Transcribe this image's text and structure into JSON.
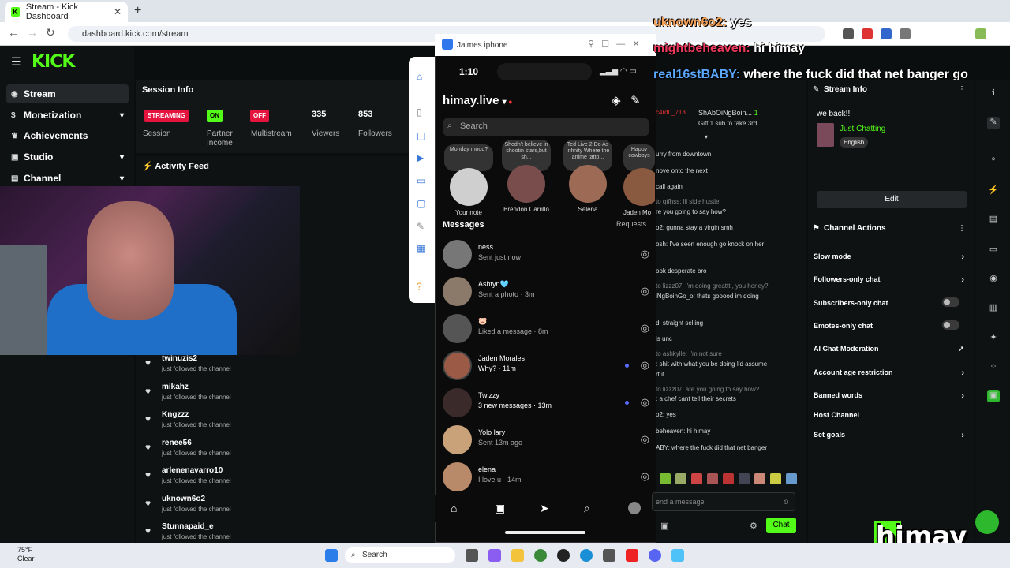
{
  "browser": {
    "tab_title": "Stream - Kick Dashboard",
    "url": "dashboard.kick.com/stream"
  },
  "kick": {
    "logo": "KICK",
    "nav": [
      {
        "label": "Stream",
        "icon": "broadcast-icon"
      },
      {
        "label": "Monetization",
        "icon": "dollar-icon"
      },
      {
        "label": "Achievements",
        "icon": "trophy-icon"
      },
      {
        "label": "Studio",
        "icon": "studio-icon"
      },
      {
        "label": "Channel",
        "icon": "channel-icon"
      }
    ],
    "session": {
      "title": "Session Info",
      "streaming": "STREAMING",
      "session_label": "Session",
      "partner_on": "ON",
      "partner_label": "Partner Income",
      "multistream_off": "OFF",
      "multistream_label": "Multistream",
      "viewers": "335",
      "viewers_label": "Viewers",
      "followers": "853",
      "followers_label": "Followers"
    },
    "feed": {
      "title": "Activity Feed",
      "items": [
        {
          "name": "twinuzis2",
          "sub": "just followed the channel"
        },
        {
          "name": "mikahz",
          "sub": "just followed the channel"
        },
        {
          "name": "Kngzzz",
          "sub": "just followed the channel"
        },
        {
          "name": "renee56",
          "sub": "just followed the channel"
        },
        {
          "name": "arlenenavarro10",
          "sub": "just followed the channel"
        },
        {
          "name": "uknown6o2",
          "sub": "just followed the channel"
        },
        {
          "name": "Stunnapaid_e",
          "sub": "just followed the channel"
        }
      ]
    }
  },
  "phone": {
    "window_title": "Jaimes iphone",
    "time": "1:10",
    "username": "himay.live",
    "search_placeholder": "Search",
    "stories": [
      {
        "note": "Monday mood?",
        "name": "Your note"
      },
      {
        "note": "Shedn't believe in shootin stars,but sh...",
        "name": "Brendon Carrillo"
      },
      {
        "note": "Ted Live 2 Do As Infinity Where the anime tatto...",
        "name": "Selena"
      },
      {
        "note": "Happy cowboys",
        "name": "Jaden Mo"
      }
    ],
    "messages_label": "Messages",
    "requests_label": "Requests",
    "messages": [
      {
        "name": "ness",
        "sub": "Sent just now"
      },
      {
        "name": "Ashtyn🩵",
        "sub": "Sent a photo · 3m"
      },
      {
        "name": "🐷",
        "sub": "Liked a message · 8m"
      },
      {
        "name": "Jaden Morales",
        "sub": "Why? · 11m"
      },
      {
        "name": "Twizzy",
        "sub": "3 new messages · 13m"
      },
      {
        "name": "Yolo lary",
        "sub": "Sent 13m ago"
      },
      {
        "name": "elena",
        "sub": "I love u · 14m"
      }
    ]
  },
  "overlay_chat": [
    {
      "user": "uknown6o2:",
      "text": "yes"
    },
    {
      "user": "mightbeheaven:",
      "text": "hi himay"
    },
    {
      "user": "real16stBABY:",
      "text": "where the fuck did that net banger go"
    }
  ],
  "chat": {
    "pinned_user": "ShAbOiNgBoin...",
    "pinned_count": "1",
    "pinned_sub": "Gift 1 sub to take 3rd",
    "lines": [
      "urry from downtown",
      "nove onto the next",
      "call again",
      "to qtfhss: lil side hustle",
      "re you going to say how?",
      "o2: gunna stay a virgin smh",
      "osh: I've seen enough go knock on her",
      "ook desperate bro",
      "to lizzz07: i'm doing greattt , you honey?",
      "iNgBoinGo_o: thats gooood im doing",
      "d: straight selling",
      "is unc",
      "to ashkylle: I'm not sure",
      ": shit with what you be doing I'd assume",
      "rt it",
      "to lizzz07: are you going to say how?",
      ": a chef cant tell their secrets",
      "o2: yes",
      "beheaven: hi himay",
      "ABY: where the fuck did that net banger"
    ],
    "input_placeholder": "end a message",
    "send_label": "Chat"
  },
  "stream_info": {
    "title": "Stream Info",
    "status": "we back!!",
    "category": "Just Chatting",
    "language": "English",
    "edit_label": "Edit"
  },
  "channel_actions": {
    "title": "Channel Actions",
    "items": [
      "Slow mode",
      "Followers-only chat",
      "Subscribers-only chat",
      "Emotes-only chat",
      "AI Chat Moderation",
      "Account age restriction",
      "Banned words",
      "Host Channel",
      "Set goals"
    ]
  },
  "brand": {
    "text": "himay",
    "accent": "#53fc18"
  },
  "taskbar": {
    "temp": "75°F",
    "weather": "Clear",
    "search": "Search"
  }
}
